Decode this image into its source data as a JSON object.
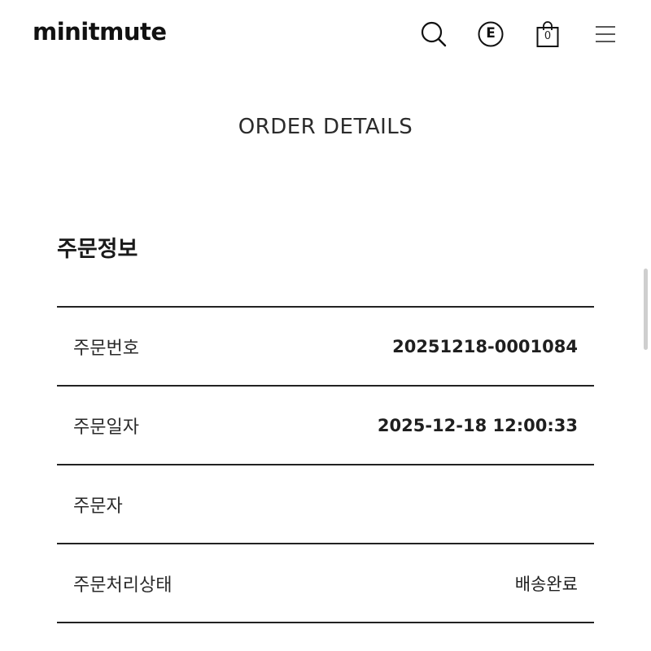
{
  "header": {
    "logo": "minitmute",
    "icons": {
      "search": "search-icon",
      "e_badge": "E",
      "bag_count": "0",
      "menu": "hamburger-menu-icon"
    }
  },
  "page": {
    "title": "ORDER DETAILS"
  },
  "order_info": {
    "heading": "주문정보",
    "rows": [
      {
        "label": "주문번호",
        "value": "20251218-0001084"
      },
      {
        "label": "주문일자",
        "value": "2025-12-18 12:00:33"
      },
      {
        "label": "주문자",
        "value": ""
      },
      {
        "label": "주문처리상태",
        "value": "배송완료"
      }
    ]
  },
  "colors": {
    "text": "#1a1a1a",
    "divider": "#222222",
    "background": "#ffffff"
  }
}
